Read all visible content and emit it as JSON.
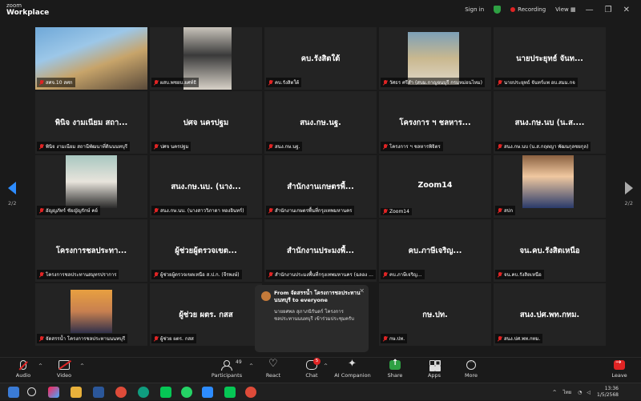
{
  "app": {
    "brand_small": "zoom",
    "brand_name": "Workplace"
  },
  "titlebar": {
    "sign_in": "Sign in",
    "recording": "Recording",
    "view": "View"
  },
  "pagination": {
    "left": "2/2",
    "right": "2/2"
  },
  "tiles": [
    {
      "name": "",
      "label": "สศจ.10 สศก",
      "video": true
    },
    {
      "name": "",
      "label": "ผสบ.พชยบ.ยศท์ธิ",
      "video": true
    },
    {
      "name": "คบ.รังสิตใต้",
      "label": "คบ.รังสิตใต้",
      "video": false
    },
    {
      "name": "",
      "label": "วัศธร ศรีสำ (สบม.กาญจนบุรี กรมหม่อนไหม)",
      "video": true
    },
    {
      "name": "นายประยุทธ์ จันท...",
      "label": "นายประยุทธ์ จันทร์แพ อบ.สมม.กจ",
      "video": false
    },
    {
      "name": "พินิจ งามเนียม สถา...",
      "label": "พินิจ งามเนียม สถานีพัฒนาที่ดินนนทบุรี",
      "video": false
    },
    {
      "name": "ปศจ นครปฐม",
      "label": "ปศจ นครปฐม",
      "video": false
    },
    {
      "name": "สนง.กษ.นฐ.",
      "label": "สนง.กษ.นฐ.",
      "video": false
    },
    {
      "name": "โครงการ ฯ ชลหาร...",
      "label": "โครงการ ฯ ชลหารพิจิตร",
      "video": false
    },
    {
      "name": "สนง.กษ.นบ (น.ส....",
      "label": "สนง.กษ.นบ (น.ส.กฤตญา พัฒนกุลชยกุล)",
      "video": false
    },
    {
      "name": "",
      "label": "อัญญภัทร์ ชัยญัญรักษ์ คย์",
      "video": true
    },
    {
      "name": "สนง.กษ.นบ. (นาง...",
      "label": "สนง.กษ.นบ. (นางสาววิภาดา ทองอินทร์)",
      "video": false
    },
    {
      "name": "สำนักงานเกษตรพื้...",
      "label": "สำนักงานเกษตรพื้นที่กรุงเทพมหานคร",
      "video": false
    },
    {
      "name": "Zoom14",
      "label": "Zoom14",
      "video": false
    },
    {
      "name": "",
      "label": "สปก",
      "video": true
    },
    {
      "name": "โครงการชลประทา...",
      "label": "โครงการชลประทานสมุทรปราการ",
      "video": false
    },
    {
      "name": "ผู้ช่วยผู้ตรวจเขต...",
      "label": "ผู้ช่วยผู้ตรวจเขตเหนือ ส.ป.ก. (จีรพงษ์)",
      "video": false
    },
    {
      "name": "สำนักงานประมงพื้...",
      "label": "สำนักงานประมงพื้นที่กรุงเทพมหานคร (ฉลอง ...",
      "video": false
    },
    {
      "name": "คบ.ภาษีเจริญ...",
      "label": "คบ.ภาษีเจริญ...",
      "video": false
    },
    {
      "name": "จน.คบ.รังสิตเหนือ",
      "label": "จน.คบ.รังสิตเหนือ",
      "video": false
    },
    {
      "name": "",
      "label": "จัดสรรน้ำ โครงการชลประทานนนทบุรี",
      "video": true
    },
    {
      "name": "ผู้ช่วย ผตร. กสส",
      "label": "ผู้ช่วย ผตร. กสส",
      "video": false
    },
    {
      "name": "",
      "label": "",
      "video": false
    },
    {
      "name": "กษ.ปท.",
      "label": "กษ.ปท.",
      "video": false
    },
    {
      "name": "สนง.ปศ.พท.กทม.",
      "label": "สนง.ปศ.พท.กทม.",
      "video": false
    }
  ],
  "chat_popup": {
    "from": "From จัดสรรน้ำ โครงการชลประทานนนทบุรี to everyone",
    "message": "นายยศพล สุภาภนิรันดร์ โครงการชลประทานนนทบุรี เข้าร่วมประชุมครับ"
  },
  "toolbar": {
    "audio": "Audio",
    "video": "Video",
    "participants": "Participants",
    "participants_count": "49",
    "react": "React",
    "chat": "Chat",
    "chat_badge": "5",
    "ai": "AI Companion",
    "share": "Share",
    "apps": "Apps",
    "more": "More",
    "leave": "Leave"
  },
  "taskbar": {
    "lang": "ไทย",
    "time": "13:36",
    "date": "1/5/2568"
  }
}
